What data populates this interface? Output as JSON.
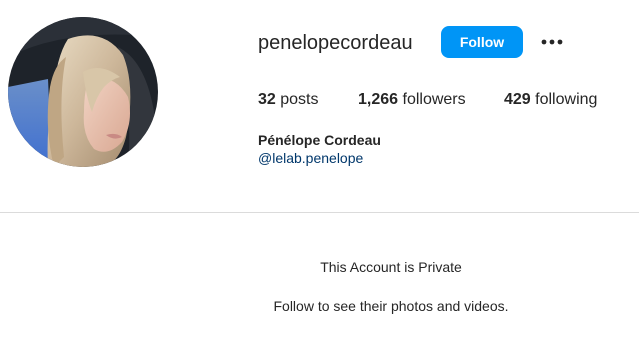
{
  "profile": {
    "username": "penelopecordeau",
    "follow_label": "Follow",
    "options_icon": "more-horizontal-icon",
    "full_name": "Pénélope Cordeau",
    "handle": "@lelab.penelope",
    "stats": {
      "posts_count": "32",
      "posts_label": "posts",
      "followers_count": "1,266",
      "followers_label": "followers",
      "following_count": "429",
      "following_label": "following"
    }
  },
  "private": {
    "title": "This Account is Private",
    "message": "Follow to see their photos and videos."
  },
  "colors": {
    "accent": "#0095f6",
    "text": "#262626",
    "link": "#00376b",
    "divider": "#dbdbdb"
  }
}
